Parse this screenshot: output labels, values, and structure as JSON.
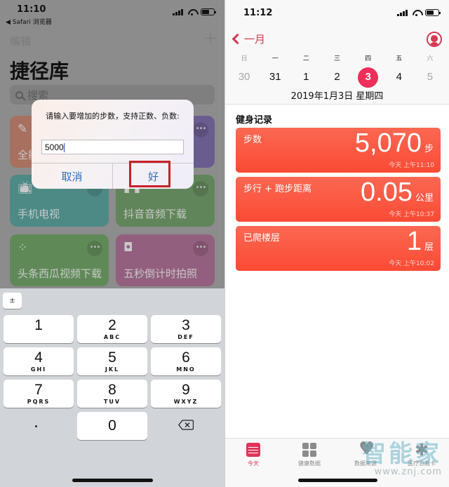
{
  "left": {
    "status": {
      "time": "11:10",
      "back_app": "◀ Safari 浏览器"
    },
    "nav": {
      "edit": "编辑",
      "add": "+"
    },
    "title": "捷径库",
    "search": {
      "placeholder": "搜索"
    },
    "shortcuts": [
      {
        "label": "全能",
        "color": "#a8705f",
        "icon": "magic-wand"
      },
      {
        "label": "",
        "color": "#6b5c8f",
        "icon": ""
      },
      {
        "label": "手机电视",
        "color": "#4d8a85",
        "icon": "tv"
      },
      {
        "label": "抖音音频下载",
        "color": "#61855a",
        "icon": "mic"
      },
      {
        "label": "头条西瓜视频下载",
        "color": "#5f8a58",
        "icon": "spinner"
      },
      {
        "label": "五秒倒计时拍照",
        "color": "#935f7e",
        "icon": "camera"
      }
    ],
    "more_glyph": "•••",
    "dialog": {
      "message": "请输入要增加的步数，支持正数、负数:",
      "input_value": "5000",
      "cancel": "取消",
      "ok": "好",
      "highlight_color": "#c8202a"
    },
    "keyboard": {
      "plus_minus": "±",
      "keys": [
        {
          "n": "1",
          "l": ""
        },
        {
          "n": "2",
          "l": "ABC"
        },
        {
          "n": "3",
          "l": "DEF"
        },
        {
          "n": "4",
          "l": "GHI"
        },
        {
          "n": "5",
          "l": "JKL"
        },
        {
          "n": "6",
          "l": "MNO"
        },
        {
          "n": "7",
          "l": "PQRS"
        },
        {
          "n": "8",
          "l": "TUV"
        },
        {
          "n": "9",
          "l": "WXYZ"
        },
        {
          "n": "0",
          "l": ""
        }
      ]
    }
  },
  "right": {
    "status": {
      "time": "11:12"
    },
    "back_label": "一月",
    "weekdays": [
      "日",
      "一",
      "二",
      "三",
      "四",
      "五",
      "六"
    ],
    "days": [
      "30",
      "31",
      "1",
      "2",
      "3",
      "4",
      "5"
    ],
    "selected_day_index": 4,
    "date_line": "2019年1月3日 星期四",
    "section_title": "健身记录",
    "metrics": [
      {
        "name": "步数",
        "value": "5,070",
        "unit": "步",
        "time": "今天 上午11:10"
      },
      {
        "name": "步行 + 跑步距离",
        "value": "0.05",
        "unit": "公里",
        "time": "今天 上午10:37"
      },
      {
        "name": "已爬楼层",
        "value": "1",
        "unit": "层",
        "time": "今天 上午10:02"
      }
    ],
    "tabs": [
      {
        "label": "今天",
        "active": true
      },
      {
        "label": "健康数据",
        "active": false
      },
      {
        "label": "数据来源",
        "active": false
      },
      {
        "label": "医疗急救卡",
        "active": false
      }
    ],
    "accent": "#e0345a",
    "watermark": {
      "line1": "智能家",
      "line2": "www.znj.com"
    }
  }
}
